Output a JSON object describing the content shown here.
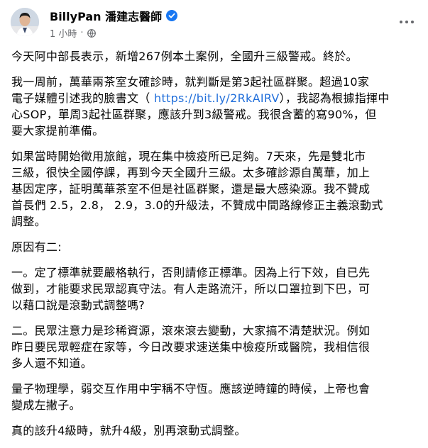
{
  "post": {
    "author": "BillyPan 潘建志醫師",
    "time": "1 小時",
    "dot": "·",
    "paragraphs": [
      {
        "lines": [
          "今天阿中部長表示，新增267例本土案例，全國升三級警戒。終於。"
        ]
      },
      {
        "lines": [
          "我一周前，萬華兩茶室女確診時，就判斷是第3起社區群聚。超過10家",
          "電子媒體引述我的臉書文（ ",
          "https://bit.ly/2RkAIRV",
          "），我認為根據指揮中",
          "心SOP，單周3起社區群聚，應該升到3級警戒。我很含蓄的寫90%，但",
          "要大家提前準備。"
        ]
      },
      {
        "lines": [
          "如果當時開始徵用旅館，現在集中檢疫所已足夠。7天來，先是雙北市",
          "三級，很快全國停課，再到今天全國升三級。太多確診源自萬華，加上",
          "基因定序，証明萬華茶室不但是社區群聚，還是最大感染源。我不贊成",
          "首長們 2.5，2.8， 2.9，3.0的升級法，不贊成中間路線修正主義滾動式",
          "調整。"
        ]
      },
      {
        "lines": [
          "原因有二:"
        ]
      },
      {
        "lines": [
          "一。定了標準就要嚴格執行，否則請修正標準。因為上行下效，自已先",
          "做到，才能要求民眾認真守法。有人走路流汗，所以口罩拉到下巴，可",
          "以藉口說是滾動式調整嗎?"
        ]
      },
      {
        "lines": [
          "二。民眾注意力是珍稀資源，滾來滾去變動，大家搞不清楚狀況。例如",
          "昨日要民眾輕症在家等，今日改要求速送集中檢疫所或醫院，我相信很",
          "多人還不知道。"
        ]
      },
      {
        "lines": [
          "量子物理學，弱交互作用中宇稱不守恆。應該逆時鐘的時候，上帝也會",
          "變成左撇子。"
        ]
      },
      {
        "lines": [
          "真的該升4級時，就升4級，別再滾動式調整。"
        ]
      }
    ]
  },
  "icons": {
    "verified": "verified-badge-icon",
    "globe": "public-globe-icon",
    "more": "more-options-icon"
  },
  "colors": {
    "link": "#216fdb",
    "verified": "#1877f2",
    "meta": "#65676b"
  }
}
